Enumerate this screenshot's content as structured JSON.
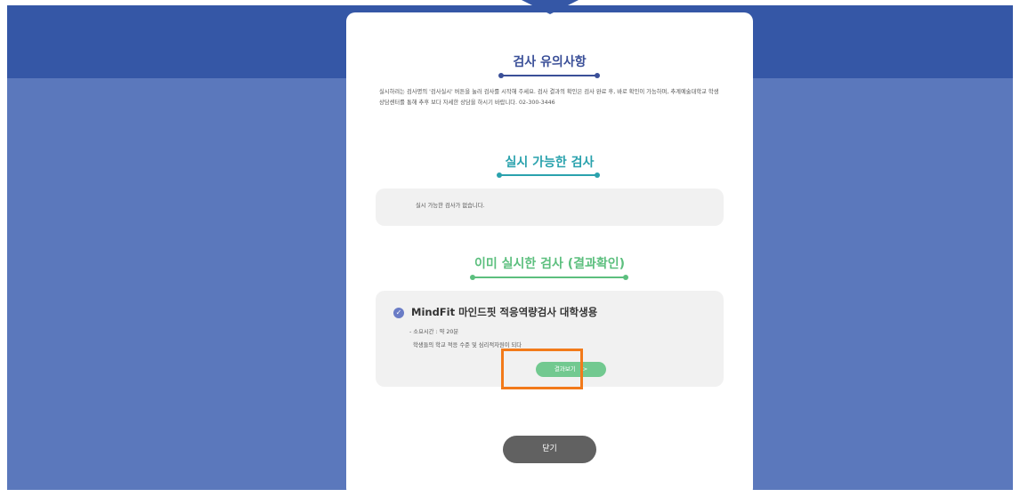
{
  "sections": {
    "notice": {
      "title": "검사 유의사항",
      "text": "실시하려는 검사명의 '검사실시' 버튼을 눌러 검사를 시작해 주세요. 검사 결과의 확인은 검사 완료 후, 바로 확인이 가능하며, 추계예술대학교 학생상담센터를 통해 추후 보다 자세한 상담을 하시기 바랍니다. 02-300-3446"
    },
    "available": {
      "title": "실시 가능한 검사",
      "empty_message": "실시 가능한 검사가 없습니다."
    },
    "completed": {
      "title": "이미 실시한 검사 (결과확인)",
      "items": [
        {
          "title": "MindFit 마인드핏 적응역량검사 대학생용",
          "time": "- 소요시간 : 약 20분",
          "desc": "학생들의 학교 적응 수준 및 심리적자원이 되다",
          "button_label": "결과보기",
          "button_arrow": ">"
        }
      ]
    }
  },
  "close_button_label": "닫기",
  "colors": {
    "header_bg": "#3557a6",
    "page_bg": "#5b78bc",
    "title_notice": "#3a4f98",
    "title_available": "#2aa2ad",
    "title_completed": "#5cbf7e",
    "highlight": "#f27a1a"
  }
}
